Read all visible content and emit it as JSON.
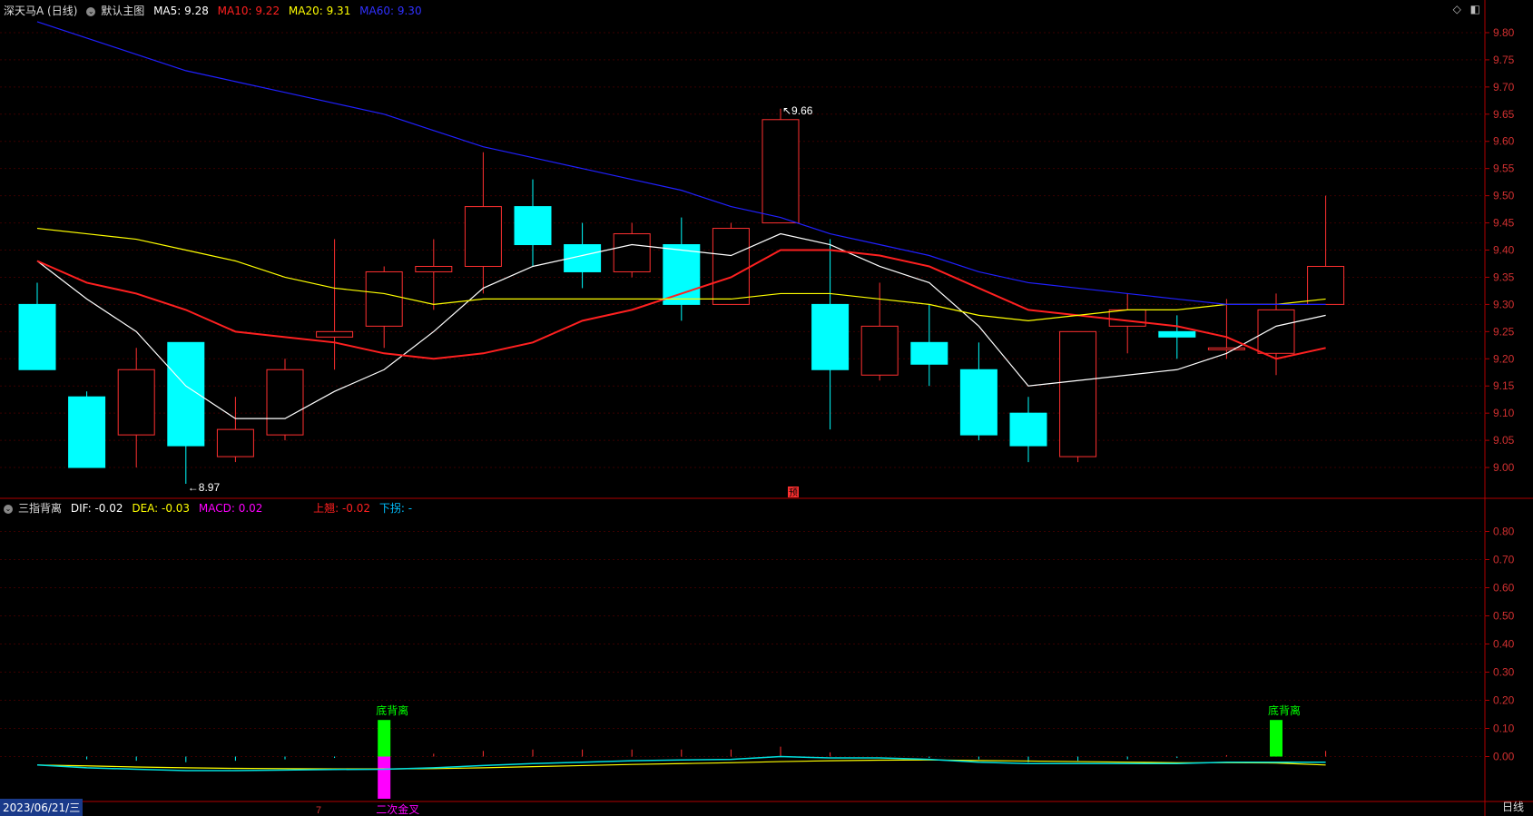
{
  "main_header": {
    "title": "深天马A (日线)",
    "template_label": "默认主图",
    "ma5_label": "MA5: 9.28",
    "ma10_label": "MA10: 9.22",
    "ma20_label": "MA20: 9.31",
    "ma60_label": "MA60: 9.30",
    "colors": {
      "ma5": "#ffffff",
      "ma10": "#ff2020",
      "ma20": "#ffff00",
      "ma60": "#2020ff"
    }
  },
  "sub_header": {
    "indicator": "三指背离",
    "dif_label": "DIF: -0.02",
    "dea_label": "DEA: -0.03",
    "macd_label": "MACD: 0.02",
    "up_label": "上翘: -0.02",
    "down_label": "下拐: -"
  },
  "icons": {
    "diamond": "diamond-icon",
    "panel": "panel-toggle-icon",
    "collapse": "collapse-icon"
  },
  "footer": {
    "date": "2023/06/21/三",
    "month_mark": "7",
    "period": "日线"
  },
  "chart_data": [
    {
      "type": "candlestick",
      "title": "深天马A (日线)",
      "ylim": [
        8.95,
        9.83
      ],
      "y_ticks": [
        "9.00",
        "9.05",
        "9.10",
        "9.15",
        "9.20",
        "9.25",
        "9.30",
        "9.35",
        "9.40",
        "9.45",
        "9.50",
        "9.55",
        "9.60",
        "9.65",
        "9.70",
        "9.75",
        "9.80"
      ],
      "candles": [
        {
          "o": 9.3,
          "c": 9.18,
          "h": 9.34,
          "l": 9.18
        },
        {
          "o": 9.13,
          "c": 9.0,
          "h": 9.14,
          "l": 9.0
        },
        {
          "o": 9.06,
          "c": 9.18,
          "h": 9.22,
          "l": 9.0
        },
        {
          "o": 9.23,
          "c": 9.04,
          "h": 9.23,
          "l": 8.97
        },
        {
          "o": 9.02,
          "c": 9.07,
          "h": 9.13,
          "l": 9.01
        },
        {
          "o": 9.06,
          "c": 9.18,
          "h": 9.2,
          "l": 9.05
        },
        {
          "o": 9.24,
          "c": 9.25,
          "h": 9.42,
          "l": 9.18
        },
        {
          "o": 9.26,
          "c": 9.36,
          "h": 9.37,
          "l": 9.22
        },
        {
          "o": 9.36,
          "c": 9.37,
          "h": 9.42,
          "l": 9.29
        },
        {
          "o": 9.37,
          "c": 9.48,
          "h": 9.58,
          "l": 9.32
        },
        {
          "o": 9.48,
          "c": 9.41,
          "h": 9.53,
          "l": 9.37
        },
        {
          "o": 9.41,
          "c": 9.36,
          "h": 9.45,
          "l": 9.33
        },
        {
          "o": 9.36,
          "c": 9.43,
          "h": 9.45,
          "l": 9.35
        },
        {
          "o": 9.41,
          "c": 9.3,
          "h": 9.46,
          "l": 9.27
        },
        {
          "o": 9.3,
          "c": 9.44,
          "h": 9.45,
          "l": 9.3
        },
        {
          "o": 9.45,
          "c": 9.64,
          "h": 9.66,
          "l": 9.45
        },
        {
          "o": 9.3,
          "c": 9.18,
          "h": 9.42,
          "l": 9.07
        },
        {
          "o": 9.17,
          "c": 9.26,
          "h": 9.34,
          "l": 9.16
        },
        {
          "o": 9.23,
          "c": 9.19,
          "h": 9.3,
          "l": 9.15
        },
        {
          "o": 9.18,
          "c": 9.06,
          "h": 9.23,
          "l": 9.05
        },
        {
          "o": 9.1,
          "c": 9.04,
          "h": 9.13,
          "l": 9.01
        },
        {
          "o": 9.02,
          "c": 9.25,
          "h": 9.25,
          "l": 9.01
        },
        {
          "o": 9.26,
          "c": 9.29,
          "h": 9.32,
          "l": 9.21
        },
        {
          "o": 9.25,
          "c": 9.24,
          "h": 9.28,
          "l": 9.2
        },
        {
          "o": 9.22,
          "c": 9.22,
          "h": 9.31,
          "l": 9.2
        },
        {
          "o": 9.21,
          "c": 9.29,
          "h": 9.32,
          "l": 9.17
        },
        {
          "o": 9.3,
          "c": 9.37,
          "h": 9.5,
          "l": 9.3
        }
      ],
      "series": [
        {
          "name": "MA5",
          "color": "#ffffff",
          "values": [
            9.38,
            9.31,
            9.25,
            9.15,
            9.09,
            9.09,
            9.14,
            9.18,
            9.25,
            9.33,
            9.37,
            9.39,
            9.41,
            9.4,
            9.39,
            9.43,
            9.41,
            9.37,
            9.34,
            9.26,
            9.15,
            9.16,
            9.17,
            9.18,
            9.21,
            9.26,
            9.28
          ]
        },
        {
          "name": "MA10",
          "color": "#ff2020",
          "values": [
            9.38,
            9.34,
            9.32,
            9.29,
            9.25,
            9.24,
            9.23,
            9.21,
            9.2,
            9.21,
            9.23,
            9.27,
            9.29,
            9.32,
            9.35,
            9.4,
            9.4,
            9.39,
            9.37,
            9.33,
            9.29,
            9.28,
            9.27,
            9.26,
            9.24,
            9.2,
            9.22
          ]
        },
        {
          "name": "MA20",
          "color": "#ffff00",
          "values": [
            9.44,
            9.43,
            9.42,
            9.4,
            9.38,
            9.35,
            9.33,
            9.32,
            9.3,
            9.31,
            9.31,
            9.31,
            9.31,
            9.31,
            9.31,
            9.32,
            9.32,
            9.31,
            9.3,
            9.28,
            9.27,
            9.28,
            9.29,
            9.29,
            9.3,
            9.3,
            9.31
          ]
        },
        {
          "name": "MA60",
          "color": "#2020ff",
          "values": [
            9.82,
            9.79,
            9.76,
            9.73,
            9.71,
            9.69,
            9.67,
            9.65,
            9.62,
            9.59,
            9.57,
            9.55,
            9.53,
            9.51,
            9.48,
            9.46,
            9.43,
            9.41,
            9.39,
            9.36,
            9.34,
            9.33,
            9.32,
            9.31,
            9.3,
            9.3,
            9.3
          ]
        }
      ],
      "annotations": [
        {
          "candle": 15,
          "text": "9.66",
          "at": "high"
        },
        {
          "candle": 3,
          "text": "8.97",
          "at": "low"
        }
      ],
      "forecast_marker": "预"
    },
    {
      "type": "macd",
      "title": "三指背离",
      "ylim": [
        -0.15,
        0.85
      ],
      "y_ticks": [
        "0.00",
        "0.10",
        "0.20",
        "0.30",
        "0.40",
        "0.50",
        "0.60",
        "0.70",
        "0.80"
      ],
      "dif": [
        -0.03,
        -0.04,
        -0.045,
        -0.05,
        -0.05,
        -0.048,
        -0.046,
        -0.045,
        -0.04,
        -0.032,
        -0.025,
        -0.02,
        -0.015,
        -0.012,
        -0.01,
        0.0,
        -0.005,
        -0.005,
        -0.01,
        -0.02,
        -0.025,
        -0.025,
        -0.025,
        -0.025,
        -0.02,
        -0.02,
        -0.02
      ],
      "dea": [
        -0.03,
        -0.033,
        -0.037,
        -0.04,
        -0.042,
        -0.043,
        -0.044,
        -0.044,
        -0.043,
        -0.04,
        -0.036,
        -0.032,
        -0.028,
        -0.025,
        -0.022,
        -0.018,
        -0.015,
        -0.013,
        -0.012,
        -0.014,
        -0.016,
        -0.018,
        -0.02,
        -0.022,
        -0.022,
        -0.023,
        -0.03
      ],
      "macd": [
        0.0,
        -0.01,
        -0.015,
        -0.02,
        -0.015,
        -0.01,
        -0.005,
        0.0,
        0.01,
        0.02,
        0.025,
        0.025,
        0.025,
        0.025,
        0.025,
        0.035,
        0.015,
        0.0,
        -0.005,
        -0.01,
        -0.02,
        -0.015,
        -0.01,
        -0.005,
        0.005,
        0.01,
        0.02
      ],
      "signals": [
        {
          "candle": 7,
          "type": "bar",
          "from": 0.0,
          "to": 0.13,
          "color": "#00ff00",
          "label": "底背离",
          "label_color": "#00ff00",
          "label_pos": "above"
        },
        {
          "candle": 7,
          "type": "bar",
          "from": 0.0,
          "to": -0.15,
          "color": "#ff00ff",
          "label": "二次金叉",
          "label_color": "#ff00ff",
          "label_pos": "below"
        },
        {
          "candle": 25,
          "type": "bar",
          "from": 0.0,
          "to": 0.13,
          "color": "#00ff00",
          "label": "底背离",
          "label_color": "#00ff00",
          "label_pos": "above"
        }
      ]
    }
  ]
}
